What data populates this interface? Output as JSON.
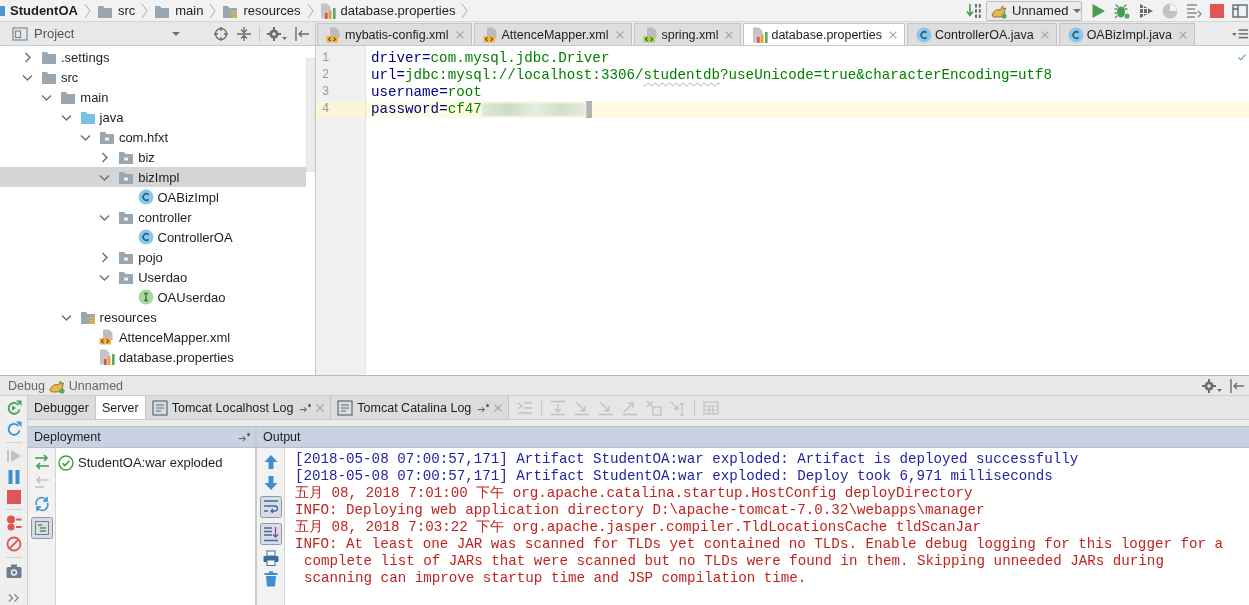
{
  "breadcrumbs": [
    {
      "label": "StudentOA",
      "kind": "module"
    },
    {
      "label": "src",
      "kind": "folder"
    },
    {
      "label": "main",
      "kind": "folder"
    },
    {
      "label": "resources",
      "kind": "resource-folder"
    },
    {
      "label": "database.properties",
      "kind": "properties"
    }
  ],
  "run_toolbar": [
    {
      "kind": "build",
      "disabled": false
    },
    {
      "kind": "configuration",
      "label": "Unnamed",
      "disabled": false
    },
    {
      "kind": "run",
      "disabled": false
    },
    {
      "kind": "debug",
      "disabled": false
    },
    {
      "kind": "coverage",
      "disabled": false
    },
    {
      "kind": "profile",
      "disabled": true
    },
    {
      "kind": "build-list",
      "disabled": false
    },
    {
      "kind": "stop",
      "disabled": false
    },
    {
      "kind": "layout",
      "disabled": false
    }
  ],
  "project_panel": {
    "title": "Project",
    "tree": [
      {
        "label": ".settings",
        "kind": "folder",
        "expanded": false,
        "selected": false
      },
      {
        "label": "src",
        "kind": "folder",
        "expanded": true,
        "selected": false,
        "children": [
          {
            "label": "main",
            "kind": "folder",
            "expanded": true,
            "selected": false,
            "children": [
              {
                "label": "java",
                "kind": "source-folder",
                "expanded": true,
                "selected": false,
                "children": [
                  {
                    "label": "com.hfxt",
                    "kind": "package",
                    "expanded": true,
                    "selected": false,
                    "children": [
                      {
                        "label": "biz",
                        "kind": "package",
                        "expanded": false,
                        "selected": false
                      },
                      {
                        "label": "bizImpl",
                        "kind": "package",
                        "expanded": true,
                        "selected": true,
                        "children": [
                          {
                            "label": "OABizImpl",
                            "kind": "class",
                            "selected": false
                          }
                        ]
                      },
                      {
                        "label": "controller",
                        "kind": "package",
                        "expanded": true,
                        "selected": false,
                        "children": [
                          {
                            "label": "ControllerOA",
                            "kind": "class",
                            "selected": false
                          }
                        ]
                      },
                      {
                        "label": "pojo",
                        "kind": "package",
                        "expanded": false,
                        "selected": false
                      },
                      {
                        "label": "Userdao",
                        "kind": "package",
                        "expanded": true,
                        "selected": false,
                        "children": [
                          {
                            "label": "OAUserdao",
                            "kind": "interface",
                            "selected": false
                          }
                        ]
                      }
                    ]
                  }
                ]
              },
              {
                "label": "resources",
                "kind": "resource-folder",
                "expanded": true,
                "selected": false,
                "children": [
                  {
                    "label": "AttenceMapper.xml",
                    "kind": "xml",
                    "selected": false
                  },
                  {
                    "label": "database.properties",
                    "kind": "properties",
                    "selected": false
                  }
                ]
              }
            ]
          }
        ]
      }
    ]
  },
  "editor": {
    "tabs": [
      {
        "label": "mybatis-config.xml",
        "kind": "xml",
        "selected": false
      },
      {
        "label": "AttenceMapper.xml",
        "kind": "xml",
        "selected": false
      },
      {
        "label": "spring.xml",
        "kind": "spring-xml",
        "selected": false
      },
      {
        "label": "database.properties",
        "kind": "properties",
        "selected": true
      },
      {
        "label": "ControllerOA.java",
        "kind": "class",
        "selected": false
      },
      {
        "label": "OABizImpl.java",
        "kind": "class",
        "selected": false
      }
    ],
    "lines": [
      {
        "number": "1",
        "key": "driver",
        "separator": "=",
        "value": [
          {
            "text": "com.mysql.jdbc.Driver",
            "typo": false
          }
        ],
        "blurred": false,
        "current": false
      },
      {
        "number": "2",
        "key": "url",
        "separator": "=",
        "value": [
          {
            "text": "jdbc:mysql://localhost:3306/",
            "typo": false
          },
          {
            "text": "studentdb",
            "typo": true
          },
          {
            "text": "?useUnicode=true&characterEncoding=utf8",
            "typo": false
          }
        ],
        "blurred": false,
        "current": false
      },
      {
        "number": "3",
        "key": "username",
        "separator": "=",
        "value": [
          {
            "text": "root",
            "typo": false
          }
        ],
        "blurred": false,
        "current": false
      },
      {
        "number": "4",
        "key": "password",
        "separator": "=",
        "value": [
          {
            "text": "cf47",
            "typo": false
          }
        ],
        "blurred": true,
        "current": true
      }
    ]
  },
  "debug": {
    "title": "Debug",
    "configuration": "Unnamed",
    "side_toolbar": [
      [
        {
          "kind": "rerun",
          "disabled": false
        },
        {
          "kind": "refresh",
          "disabled": false
        }
      ],
      [
        {
          "kind": "resume",
          "disabled": true
        },
        {
          "kind": "pause",
          "disabled": false
        },
        {
          "kind": "stop",
          "disabled": false
        }
      ],
      [
        {
          "kind": "breakpoints",
          "disabled": false
        },
        {
          "kind": "mute",
          "disabled": false
        }
      ],
      [
        {
          "kind": "camera",
          "disabled": false
        }
      ],
      [
        {
          "kind": "more",
          "disabled": false
        }
      ]
    ],
    "tabs": [
      {
        "label": "Debugger",
        "kind": "plain",
        "selected": false
      },
      {
        "label": "Server",
        "kind": "plain",
        "selected": true
      },
      {
        "label": "Tomcat Localhost Log",
        "kind": "log",
        "selected": false
      },
      {
        "label": "Tomcat Catalina Log",
        "kind": "log",
        "selected": false
      }
    ],
    "tab_toolbar": [
      [
        {
          "kind": "show-execution",
          "disabled": true
        }
      ],
      [
        {
          "kind": "step-over",
          "disabled": true
        },
        {
          "kind": "step-into",
          "disabled": true
        },
        {
          "kind": "force-step-into",
          "disabled": true
        },
        {
          "kind": "step-out",
          "disabled": true
        },
        {
          "kind": "drop-frame",
          "disabled": true
        },
        {
          "kind": "run-to-cursor",
          "disabled": true
        }
      ],
      [
        {
          "kind": "evaluate",
          "disabled": true
        }
      ]
    ],
    "deployment": {
      "title": "Deployment",
      "toolbar": [
        {
          "kind": "deploy",
          "disabled": false,
          "on": false
        },
        {
          "kind": "undeploy",
          "disabled": true,
          "on": false
        },
        {
          "kind": "redeploy",
          "disabled": false,
          "on": false
        },
        {
          "kind": "group-view",
          "disabled": false,
          "on": true
        }
      ],
      "items": [
        {
          "label": "StudentOA:war exploded",
          "deployed": true
        }
      ]
    },
    "output": {
      "title": "Output",
      "toolbar": [
        {
          "kind": "up",
          "disabled": false,
          "on": false
        },
        {
          "kind": "down",
          "disabled": false,
          "on": false
        },
        {
          "kind": "wrap",
          "disabled": false,
          "on": true
        },
        {
          "kind": "scroll-end",
          "disabled": false,
          "on": true
        },
        {
          "kind": "print",
          "disabled": false,
          "on": false
        },
        {
          "kind": "trash",
          "disabled": false,
          "on": false
        }
      ],
      "entries": [
        {
          "kind": "stdout",
          "lines": [
            "[2018-05-08 07:00:57,171] Artifact StudentOA:war exploded: Artifact is deployed successfully"
          ]
        },
        {
          "kind": "stdout",
          "lines": [
            "[2018-05-08 07:00:57,171] Artifact StudentOA:war exploded: Deploy took 6,971 milliseconds"
          ]
        },
        {
          "kind": "stderr",
          "lines": [
            "五月 08, 2018 7:01:00 下午 org.apache.catalina.startup.HostConfig deployDirectory"
          ]
        },
        {
          "kind": "stderr",
          "lines": [
            "INFO: Deploying web application directory D:\\apache-tomcat-7.0.32\\webapps\\manager"
          ]
        },
        {
          "kind": "stderr",
          "lines": [
            "五月 08, 2018 7:03:22 下午 org.apache.jasper.compiler.TldLocationsCache tldScanJar"
          ]
        },
        {
          "kind": "stderr",
          "lines": [
            "INFO: At least one JAR was scanned for TLDs yet contained no TLDs. Enable debug logging for this logger for a",
            "complete list of JARs that were scanned but no TLDs were found in them. Skipping unneeded JARs during",
            "scanning can improve startup time and JSP compilation time."
          ]
        }
      ]
    }
  }
}
